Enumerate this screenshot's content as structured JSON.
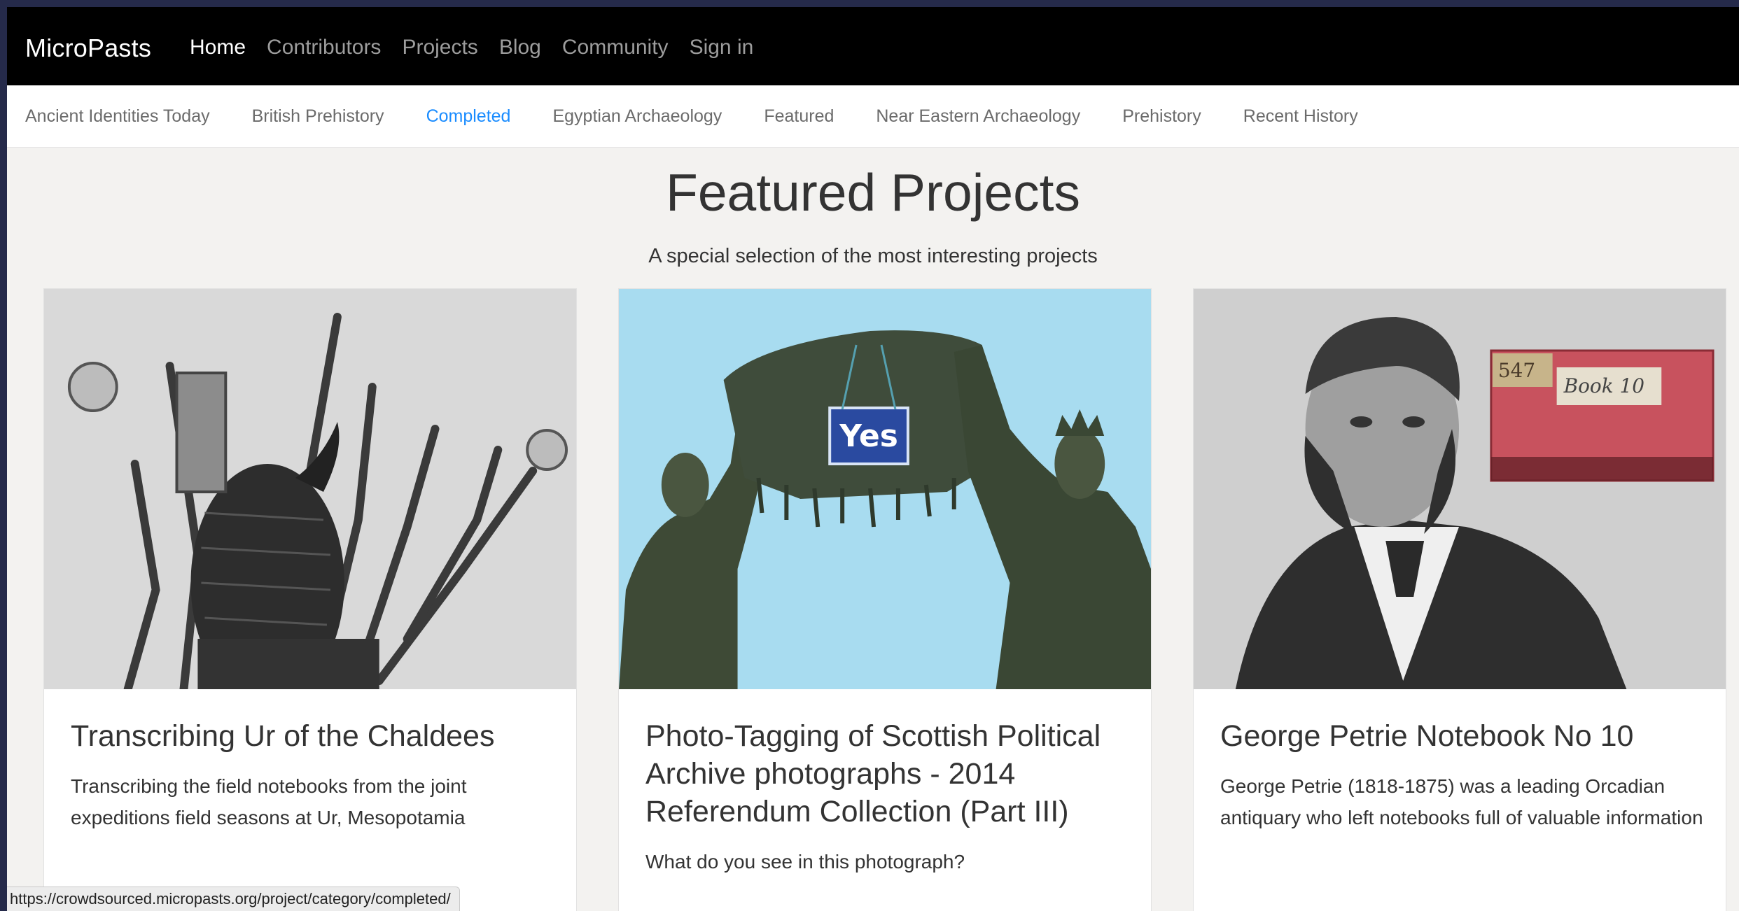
{
  "navbar": {
    "brand": "MicroPasts",
    "links": [
      "Home",
      "Contributors",
      "Projects",
      "Blog",
      "Community",
      "Sign in"
    ],
    "active": "Home"
  },
  "categories": {
    "items": [
      "Ancient Identities Today",
      "British Prehistory",
      "Completed",
      "Egyptian Archaeology",
      "Featured",
      "Near Eastern Archaeology",
      "Prehistory",
      "Recent History"
    ],
    "active": "Completed"
  },
  "page": {
    "title": "Featured Projects",
    "subtitle": "A special selection of the most interesting projects"
  },
  "cards": [
    {
      "title": "Transcribing Ur of the Chaldees",
      "description": "Transcribing the field notebooks from the joint expeditions field seasons at Ur, Mesopotamia"
    },
    {
      "title": "Photo-Tagging of Scottish Political Archive photographs - 2014 Referendum Collection (Part III)",
      "description": "What do you see in this photograph?",
      "image_sign_text": "Yes"
    },
    {
      "title": "George Petrie Notebook No 10",
      "description": "George Petrie (1818-1875) was a leading Orcadian antiquary who left notebooks full of valuable information",
      "image_label_number": "547",
      "image_label_text": "Book 10"
    }
  ],
  "status_bar": {
    "url": "https://crowdsourced.micropasts.org/project/category/completed/"
  },
  "colors": {
    "navbar_bg": "#000000",
    "link_active": "#1a8cff",
    "page_bg": "#f3f2f0"
  }
}
